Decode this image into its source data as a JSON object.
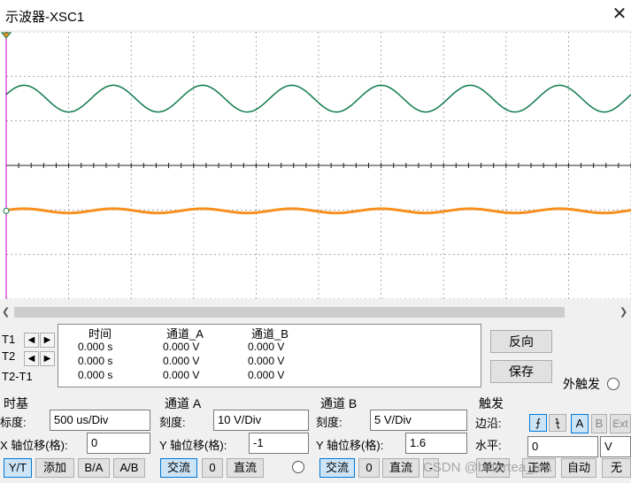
{
  "window": {
    "title": "示波器-XSC1",
    "close_label": "✕"
  },
  "colors": {
    "channel_a": "#0e7a4a",
    "channel_b": "#f7901e",
    "cursor": "#c000c0",
    "grid": "#9a9a9a"
  },
  "waveforms": {
    "channel_a": {
      "cycles": 7.0,
      "level": 0.75,
      "amplitude": 0.05
    },
    "channel_b": {
      "cycles": 7.0,
      "level": 0.33,
      "amplitude": 0.008
    }
  },
  "readout": {
    "headers": {
      "time": "时间",
      "ch_a": "通道_A",
      "ch_b": "通道_B"
    },
    "rows": [
      {
        "label": "T1",
        "time": "0.000 s",
        "a": "0.000 V",
        "b": "0.000 V"
      },
      {
        "label": "T2",
        "time": "0.000 s",
        "a": "0.000 V",
        "b": "0.000 V"
      },
      {
        "label": "T2-T1",
        "time": "0.000 s",
        "a": "0.000 V",
        "b": "0.000 V"
      }
    ]
  },
  "buttons": {
    "reverse": "反向",
    "save": "保存",
    "ext_trigger": "外触发"
  },
  "timebase": {
    "title": "时基",
    "scale_label": "标度:",
    "scale_value": "500 us/Div",
    "xpos_label": "X 轴位移(格):",
    "xpos_value": "0",
    "modes": [
      "Y/T",
      "添加",
      "B/A",
      "A/B"
    ]
  },
  "channel_a": {
    "title": "通道 A",
    "scale_label": "刻度:",
    "scale_value": "10  V/Div",
    "ypos_label": "Y 轴位移(格):",
    "ypos_value": "-1",
    "coupling": [
      "交流",
      "0",
      "直流"
    ]
  },
  "channel_b": {
    "title": "通道 B",
    "scale_label": "刻度:",
    "scale_value": "5  V/Div",
    "ypos_label": "Y 轴位移(格):",
    "ypos_value": "1.6",
    "coupling": [
      "交流",
      "0",
      "直流",
      "-"
    ]
  },
  "trigger": {
    "title": "触发",
    "edge_label": "边沿:",
    "edge_rise": "⨍",
    "edge_fall": "⨍",
    "sources": [
      "A",
      "B",
      "Ext"
    ],
    "level_label": "水平:",
    "level_value": "0",
    "level_unit": "V",
    "modes": [
      "单次",
      "正常",
      "自动",
      "无"
    ]
  },
  "watermark": "CSDN @bittertea_tea"
}
